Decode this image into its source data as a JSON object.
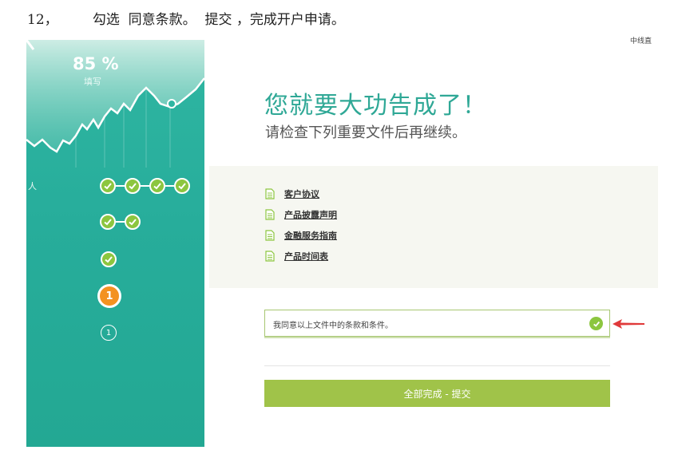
{
  "instruction": "12，        勾选  同意条款。  提交 ，完成开户申请。",
  "sidebar": {
    "progress_percent": "85 %",
    "progress_label": "填写",
    "stray_text": "人",
    "current_step": "1",
    "next_step": "1",
    "completed_rows": [
      4,
      2,
      1
    ]
  },
  "corner_text": "中线直",
  "main": {
    "headline": "您就要大功告成了！",
    "subhead": "请检查下列重要文件后再继续。",
    "documents": [
      "客户协议",
      "产品披露声明",
      "金融服务指南",
      "产品时间表"
    ],
    "agree_label": "我同意以上文件中的条款和条件。",
    "agree_checked": true,
    "submit_label": "全部完成 - 提交"
  },
  "colors": {
    "sidebar": "#2fb6a2",
    "accent_green": "#8cc63f",
    "current_step": "#f39221",
    "headline": "#2fa896",
    "submit": "#a0c349",
    "arrow": "#e03a3a"
  }
}
